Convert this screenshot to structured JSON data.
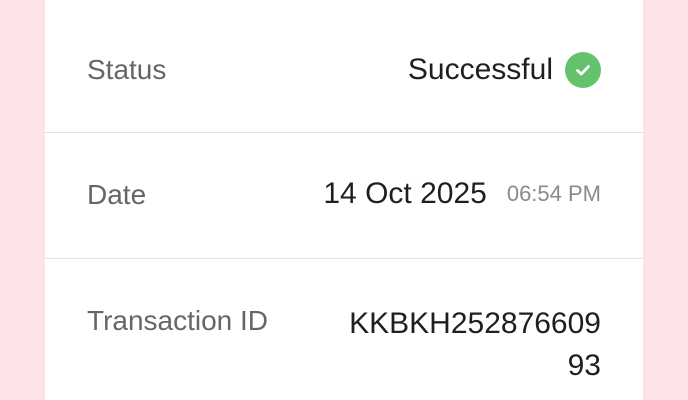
{
  "details": {
    "status": {
      "label": "Status",
      "value": "Successful",
      "icon": "check-circle-icon",
      "icon_color": "#63c26b"
    },
    "date": {
      "label": "Date",
      "value": "14 Oct 2025",
      "time": "06:54 PM"
    },
    "transaction": {
      "label": "Transaction ID",
      "value": "KKBKH25287660993"
    }
  },
  "colors": {
    "page_background": "#fce4e6",
    "card_background": "#ffffff",
    "label_text": "#666666",
    "value_text": "#1f1f1f",
    "divider": "#e3e3e3"
  }
}
